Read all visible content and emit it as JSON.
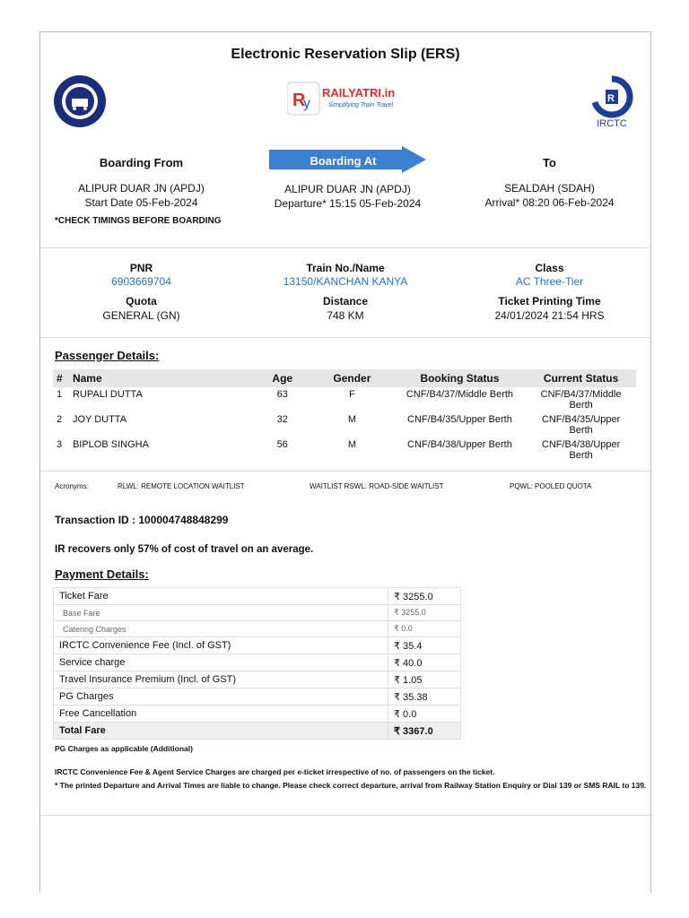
{
  "header": {
    "title": "Electronic Reservation Slip (ERS)",
    "railyatri_brand": "RAILYATRI.in",
    "railyatri_tagline": "Simplifying Train Travel",
    "irctc_label": "IRCTC",
    "ir_seal_text": "INDIAN RAILWAYS"
  },
  "journey": {
    "from_label": "Boarding From",
    "from_station": "ALIPUR DUAR JN (APDJ)",
    "start_date": "Start Date 05-Feb-2024",
    "check_note": "*CHECK TIMINGS BEFORE BOARDING",
    "at_label": "Boarding At",
    "at_station": "ALIPUR DUAR JN (APDJ)",
    "departure": "Departure* 15:15  05-Feb-2024",
    "to_label": "To",
    "to_station": "SEALDAH (SDAH)",
    "arrival": "Arrival* 08:20  06-Feb-2024"
  },
  "ticket": {
    "pnr_label": "PNR",
    "pnr": "6903669704",
    "train_label": "Train No./Name",
    "train": "13150/KANCHAN KANYA",
    "class_label": "Class",
    "class": "AC Three-Tier",
    "quota_label": "Quota",
    "quota": "GENERAL (GN)",
    "distance_label": "Distance",
    "distance": "748 KM",
    "print_label": "Ticket Printing Time",
    "print_time": "24/01/2024 21:54 HRS"
  },
  "passengers": {
    "title": "Passenger Details:",
    "headers": [
      "#",
      "Name",
      "Age",
      "Gender",
      "Booking Status",
      "Current Status"
    ],
    "rows": [
      [
        "1",
        "RUPALI DUTTA",
        "63",
        "F",
        "CNF/B4/37/Middle Berth",
        "CNF/B4/37/Middle Berth"
      ],
      [
        "2",
        "JOY DUTTA",
        "32",
        "M",
        "CNF/B4/35/Upper Berth",
        "CNF/B4/35/Upper Berth"
      ],
      [
        "3",
        "BIPLOB SINGHA",
        "56",
        "M",
        "CNF/B4/38/Upper Berth",
        "CNF/B4/38/Upper Berth"
      ]
    ]
  },
  "acronyms": {
    "label": "Acronyms:",
    "a1": "RLWL: REMOTE LOCATION WAITLIST",
    "a2": "WAITLIST RSWL: ROAD-SIDE WAITLIST",
    "a3": "PQWL: POOLED QUOTA"
  },
  "transaction": "Transaction ID : 100004748848299",
  "ir_recovers": "IR recovers only 57% of cost of travel on an average.",
  "payment": {
    "title": "Payment Details:",
    "rows": [
      {
        "label": "Ticket Fare",
        "value": "₹ 3255.0"
      },
      {
        "label": "Base Fare",
        "value": "₹ 3255.0"
      },
      {
        "label": "Catering Charges",
        "value": "₹ 0.0"
      },
      {
        "label": "IRCTC Convenience Fee (Incl. of GST)",
        "value": "₹ 35.4"
      },
      {
        "label": "Service charge",
        "value": "₹ 40.0"
      },
      {
        "label": "Travel Insurance Premium (Incl. of GST)",
        "value": "₹ 1.05"
      },
      {
        "label": "PG Charges",
        "value": "₹ 35.38"
      },
      {
        "label": "Free Cancellation",
        "value": "₹ 0.0"
      },
      {
        "label": "Total Fare",
        "value": "₹ 3367.0"
      }
    ]
  },
  "notes": {
    "pg": "PG Charges as applicable (Additional)",
    "fee": "IRCTC Convenience Fee & Agent Service Charges are charged per e-ticket irrespective of no. of passengers on the ticket.",
    "times": "* The printed Departure and Arrival Times are liable to change. Please check correct departure, arrival from Railway Station Enquiry or Dial 139 or SMS RAIL to 139."
  }
}
